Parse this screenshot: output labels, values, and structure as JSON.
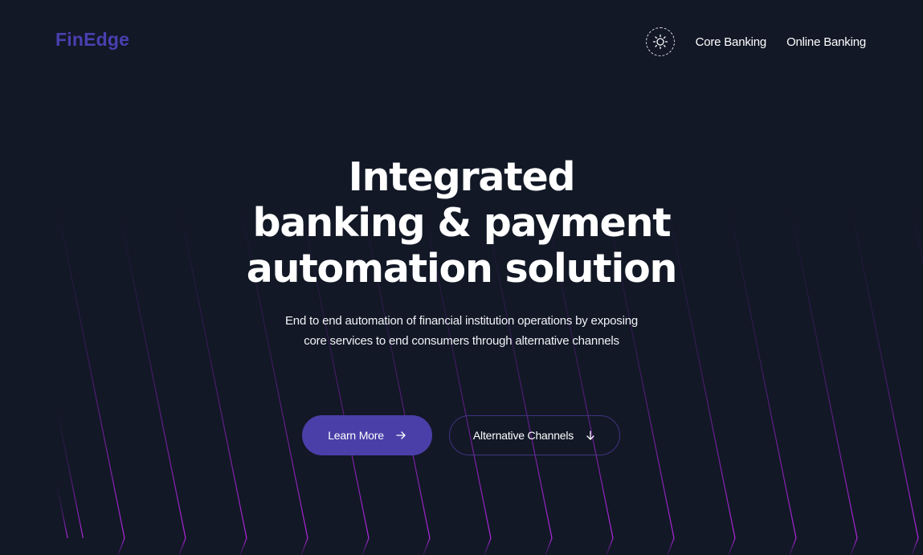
{
  "header": {
    "logo": "FinEdge",
    "theme_toggle_icon": "sun-icon",
    "nav": [
      {
        "label": "Core Banking"
      },
      {
        "label": "Online Banking"
      }
    ]
  },
  "hero": {
    "title_lines": [
      "Integrated",
      "banking & payment",
      "automation solution"
    ],
    "subtitle": "End to end automation of financial institution operations by exposing core services to end consumers through alternative channels",
    "buttons": {
      "primary": {
        "label": "Learn More",
        "icon": "arrow-right-icon"
      },
      "secondary": {
        "label": "Alternative Channels",
        "icon": "arrow-down-icon"
      }
    }
  },
  "colors": {
    "background": "#121826",
    "brand": "#4a3fb0",
    "primary_button": "#4a3fa8",
    "line_accent": "#a21fd8"
  }
}
